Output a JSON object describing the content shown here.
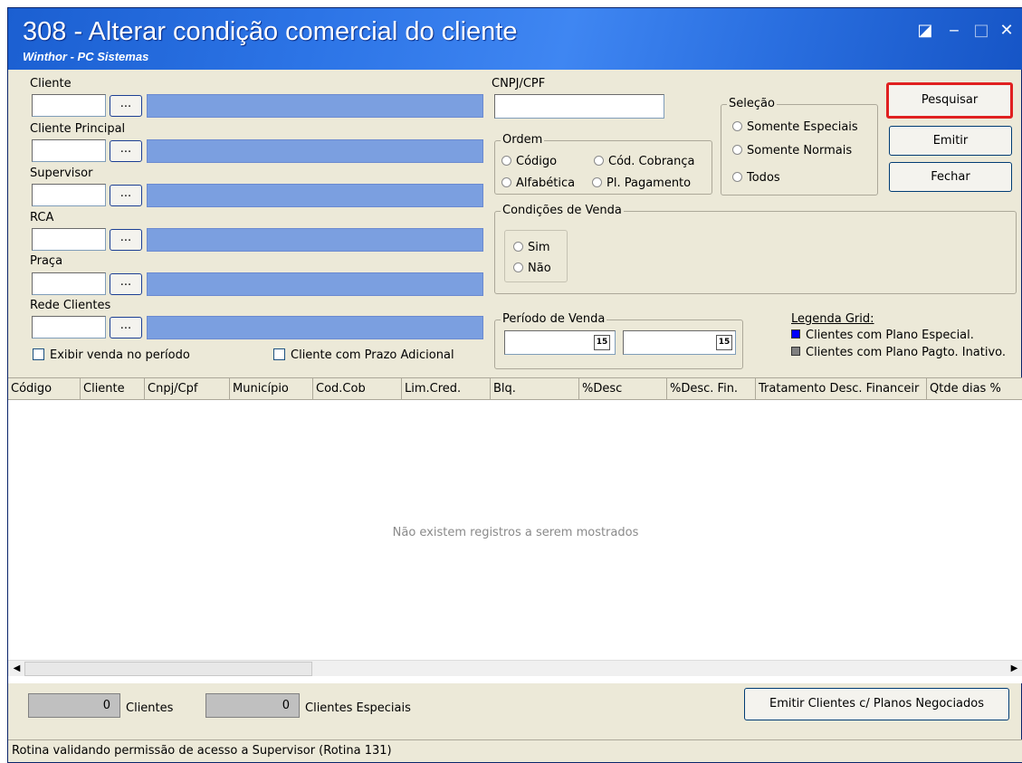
{
  "window": {
    "title": "308 - Alterar condição comercial do cliente",
    "subtitle": "Winthor - PC Sistemas"
  },
  "titlebar_icons": [
    "restore-icon",
    "minimize-icon",
    "maximize-icon",
    "close-icon"
  ],
  "fields": {
    "cliente": "Cliente",
    "cliente_principal": "Cliente Principal",
    "supervisor": "Supervisor",
    "rca": "RCA",
    "praca": "Praça",
    "rede_clientes": "Rede Clientes",
    "dots": "...",
    "cnpj_cpf": "CNPJ/CPF"
  },
  "checkboxes": {
    "exibir_venda": "Exibir venda no período",
    "prazo_adicional": "Cliente com Prazo Adicional"
  },
  "ordem": {
    "title": "Ordem",
    "codigo": "Código",
    "cod_cobranca": "Cód. Cobrança",
    "alfabetica": "Alfabética",
    "pl_pagamento": "Pl. Pagamento"
  },
  "selecao": {
    "title": "Seleção",
    "somente_especiais": "Somente Especiais",
    "somente_normais": "Somente Normais",
    "todos": "Todos"
  },
  "condicoes": {
    "title": "Condições de Venda",
    "sim": "Sim",
    "nao": "Não"
  },
  "periodo": {
    "title": "Período de Venda",
    "cal": "15"
  },
  "legend": {
    "title": "Legenda Grid:",
    "especial": "Clientes com Plano Especial.",
    "inativo": "Clientes com Plano Pagto. Inativo.",
    "color_especial": "#0000ff",
    "color_inativo": "#808080"
  },
  "buttons": {
    "pesquisar": "Pesquisar",
    "emitir": "Emitir",
    "fechar": "Fechar",
    "emitir_planos": "Emitir Clientes c/ Planos Negociados"
  },
  "grid": {
    "columns": [
      "Código",
      "Cliente",
      "Cnpj/Cpf",
      "Município",
      "Cod.Cob",
      "Lim.Cred.",
      "Blq.",
      "%Desc",
      "%Desc. Fin.",
      "Tratamento Desc. Financeir",
      "Qtde dias %"
    ],
    "empty_message": "Não existem registros a serem mostrados"
  },
  "footer": {
    "clientes_count": "0",
    "clientes_label": "Clientes",
    "especiais_count": "0",
    "especiais_label": "Clientes Especiais"
  },
  "status_bar": "Rotina validando permissão de acesso a Supervisor (Rotina 131)",
  "colors": {
    "titlebar": "#2c74e6",
    "highlight": "#e02020",
    "lookup_bar": "#7b9fe0"
  }
}
